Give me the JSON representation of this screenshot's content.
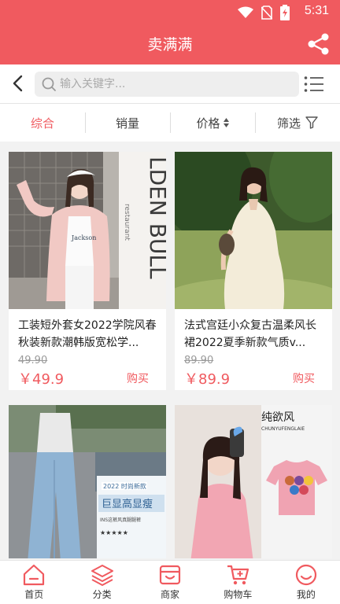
{
  "status": {
    "time": "5:31"
  },
  "header": {
    "title": "卖满满"
  },
  "search": {
    "placeholder": "输入关键字..."
  },
  "sort": {
    "tabs": [
      {
        "label": "综合"
      },
      {
        "label": "销量"
      },
      {
        "label": "价格"
      },
      {
        "label": "筛选"
      }
    ]
  },
  "products": [
    {
      "name": "工装短外套女2022学院风春秋装新款潮韩版宽松学...",
      "original_price": "49.90",
      "price": "￥49.9",
      "buy_label": "购买"
    },
    {
      "name": "法式宫廷小众复古温柔风长裙2022夏季新款气质v...",
      "original_price": "89.90",
      "price": "￥89.9",
      "buy_label": "购买"
    },
    {
      "name": "",
      "original_price": "",
      "price": "",
      "buy_label": ""
    },
    {
      "name": "",
      "original_price": "",
      "price": "",
      "buy_label": ""
    }
  ],
  "image_text": {
    "restaurant_sign": "LDEN BULL",
    "restaurant_sub": "restaurant",
    "jeans_badge": "2022 时尚新款",
    "jeans_title": "巨显高显瘦",
    "jeans_sub": "INS这裤风真腿腿裤",
    "tee_brand": "纯欲风",
    "tee_brand_sub": "CHUNYUFENGLAIE"
  },
  "tabbar": {
    "items": [
      {
        "label": "首页",
        "icon": "home-icon"
      },
      {
        "label": "分类",
        "icon": "layers-icon"
      },
      {
        "label": "商家",
        "icon": "store-icon"
      },
      {
        "label": "购物车",
        "icon": "cart-icon"
      },
      {
        "label": "我的",
        "icon": "user-icon"
      }
    ]
  },
  "colors": {
    "accent": "#f05a5f"
  }
}
